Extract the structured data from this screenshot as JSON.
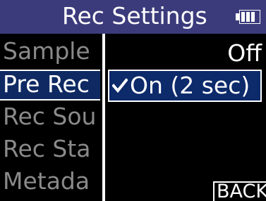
{
  "header": {
    "title": "Rec Settings",
    "battery_icon": "battery-icon"
  },
  "menu": {
    "items": [
      {
        "label": "Sample",
        "selected": false
      },
      {
        "label": "Pre Rec",
        "selected": true
      },
      {
        "label": "Rec Sou",
        "selected": false
      },
      {
        "label": "Rec Sta",
        "selected": false
      },
      {
        "label": "Metada",
        "selected": false
      }
    ]
  },
  "options": {
    "off_label": "Off",
    "on_label": "On (2 sec)",
    "selected_option": "On (2 sec)",
    "check_icon": "check-icon"
  },
  "footer": {
    "back_label": "BACK"
  },
  "colors": {
    "title_bar": "#3b3b7c",
    "selection_fill": "#0d2a6b",
    "inactive_text": "#8a8a8a",
    "active_text": "#ffffff",
    "background": "#000000"
  }
}
